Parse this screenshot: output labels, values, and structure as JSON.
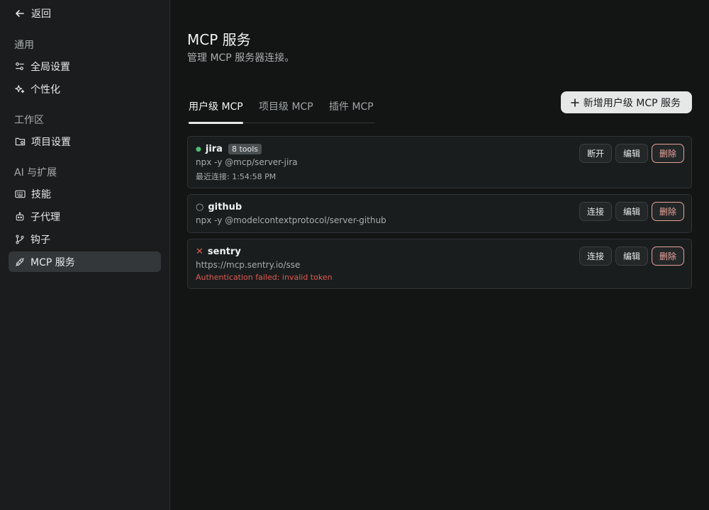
{
  "sidebar": {
    "back_label": "返回",
    "sections": [
      {
        "label": "通用",
        "items": [
          {
            "label": "全局设置",
            "icon": "sliders-icon"
          },
          {
            "label": "个性化",
            "icon": "sparkle-icon"
          }
        ]
      },
      {
        "label": "工作区",
        "items": [
          {
            "label": "项目设置",
            "icon": "folder-gear-icon"
          }
        ]
      },
      {
        "label": "AI 与扩展",
        "items": [
          {
            "label": "技能",
            "icon": "keyboard-icon"
          },
          {
            "label": "子代理",
            "icon": "robot-icon"
          },
          {
            "label": "钩子",
            "icon": "git-branch-icon"
          },
          {
            "label": "MCP 服务",
            "icon": "plug-icon",
            "active": true
          }
        ]
      }
    ]
  },
  "main": {
    "title": "MCP 服务",
    "subtitle": "管理 MCP 服务器连接。",
    "tabs": [
      {
        "label": "用户级 MCP",
        "active": true
      },
      {
        "label": "项目级 MCP"
      },
      {
        "label": "插件 MCP"
      }
    ],
    "add_button_label": "新增用户级 MCP 服务"
  },
  "servers": [
    {
      "name": "jira",
      "status": "connected",
      "status_icon": "●",
      "status_color": "#4fbf78",
      "badge": "8 tools",
      "command": "npx -y @mcp/server-jira",
      "meta": "最近连接: 1:54:58 PM",
      "buttons": {
        "primary": "断开",
        "edit": "编辑",
        "delete": "删除"
      }
    },
    {
      "name": "github",
      "status": "disconnected",
      "status_icon": "○",
      "status_color": "#a9adad",
      "command": "npx -y @modelcontextprotocol/server-github",
      "buttons": {
        "primary": "连接",
        "edit": "编辑",
        "delete": "删除"
      }
    },
    {
      "name": "sentry",
      "status": "error",
      "status_icon": "✕",
      "status_color": "#e05a4f",
      "command": "https://mcp.sentry.io/sse",
      "error": "Authentication failed: invalid token",
      "buttons": {
        "primary": "连接",
        "edit": "编辑",
        "delete": "删除"
      }
    }
  ]
}
